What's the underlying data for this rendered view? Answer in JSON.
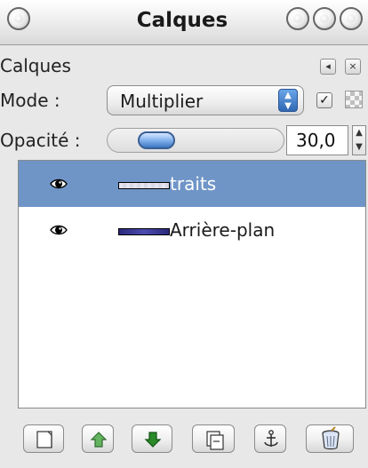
{
  "window": {
    "title": "Calques"
  },
  "panel": {
    "title": "Calques"
  },
  "mode": {
    "label": "Mode :",
    "value": "Multiplier"
  },
  "opacity": {
    "label": "Opacité :",
    "value": "30,0",
    "fraction": 0.3
  },
  "layers": [
    {
      "name": "traits",
      "selected": true,
      "visible": true
    },
    {
      "name": "Arrière-plan",
      "selected": false,
      "visible": true
    }
  ],
  "icons": {
    "titlebar_left": "menu-circle-icon",
    "titlebar_right": [
      "shade-circle-icon",
      "minimize-circle-icon",
      "close-circle-icon"
    ],
    "panel_tab_left": "tab-menu-icon",
    "panel_tab_close": "tab-close-icon",
    "preserve_transparency": "checkerboard-icon",
    "layer_visibility": "eye-icon",
    "bottom": [
      "new-layer-icon",
      "raise-layer-icon",
      "lower-layer-icon",
      "duplicate-layer-icon",
      "anchor-layer-icon",
      "delete-layer-icon"
    ]
  },
  "colors": {
    "selected_row": "#6f95c7",
    "selected_text": "#ffffff",
    "accent": "#2f67b2"
  }
}
